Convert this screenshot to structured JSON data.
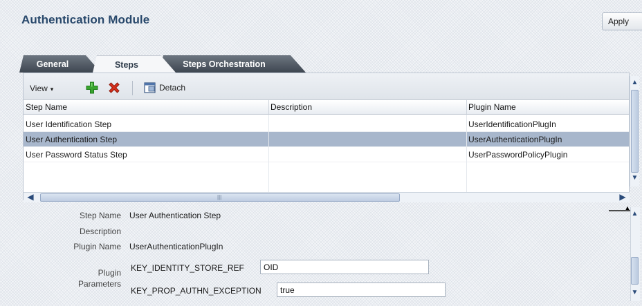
{
  "header": {
    "title": "Authentication Module",
    "apply_label": "Apply"
  },
  "tabs": [
    {
      "label": "General",
      "active": false
    },
    {
      "label": "Steps",
      "active": true
    },
    {
      "label": "Steps Orchestration",
      "active": false
    }
  ],
  "toolbar": {
    "view_label": "View",
    "view_caret": "▾",
    "add_icon": "add-plus-icon",
    "delete_icon": "delete-x-icon",
    "detach_label": "Detach"
  },
  "table": {
    "columns": [
      "Step Name",
      "Description",
      "Plugin Name"
    ],
    "rows": [
      {
        "step_name": "User Identification Step",
        "description": "",
        "plugin_name": "UserIdentificationPlugIn",
        "selected": false
      },
      {
        "step_name": "User Authentication Step",
        "description": "",
        "plugin_name": "UserAuthenticationPlugIn",
        "selected": true
      },
      {
        "step_name": "User Password Status Step",
        "description": "",
        "plugin_name": "UserPasswordPolicyPlugin",
        "selected": false
      }
    ],
    "scroll": {
      "up": "▲",
      "down": "▼",
      "left": "◀",
      "right": "▶",
      "grip": "|||",
      "splitter": "▲"
    }
  },
  "detail": {
    "step_name_label": "Step Name",
    "step_name_value": "User Authentication Step",
    "description_label": "Description",
    "description_value": "",
    "plugin_name_label": "Plugin Name",
    "plugin_name_value": "UserAuthenticationPlugIn",
    "plugin_params_label_1": "Plugin",
    "plugin_params_label_2": "Parameters",
    "params": [
      {
        "key": "KEY_IDENTITY_STORE_REF",
        "value": "OID"
      },
      {
        "key": "KEY_PROP_AUTHN_EXCEPTION",
        "value": "true"
      }
    ]
  },
  "colors": {
    "title": "#28486b",
    "selected_row": "#a8b7cc",
    "dark_tab": "#4a535e",
    "add_icon": "#3aa52f",
    "delete_icon": "#d8301c"
  }
}
